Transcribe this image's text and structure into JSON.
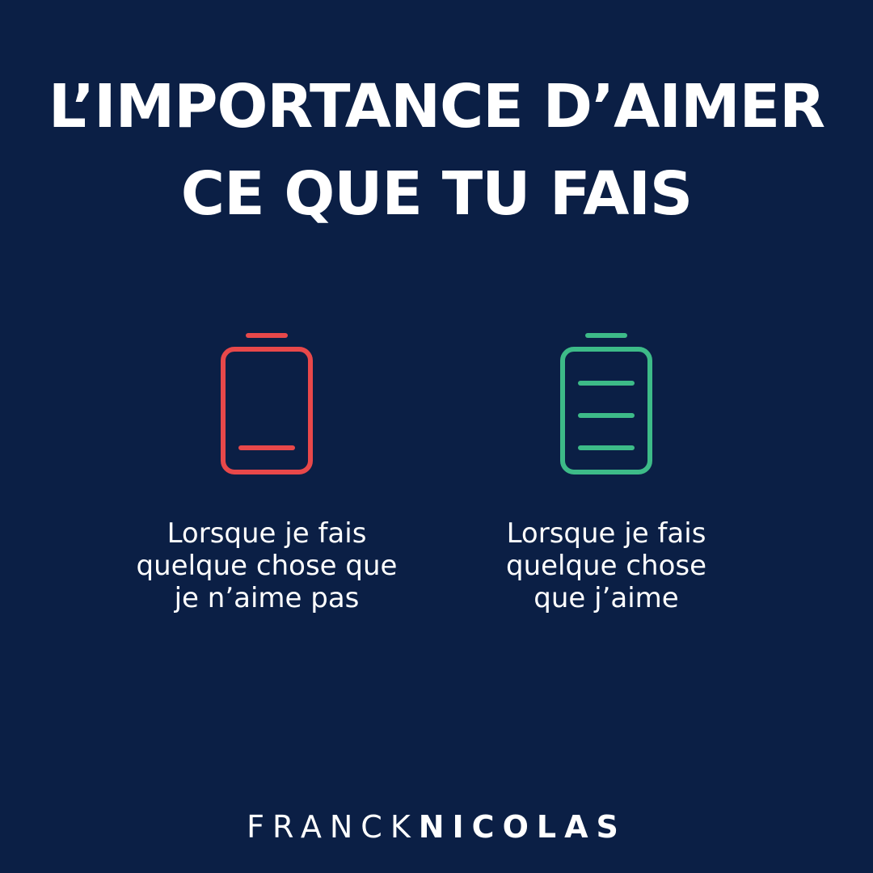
{
  "title": {
    "line1": "L’IMPORTANCE D’AIMER",
    "line2": "CE QUE TU FAIS"
  },
  "colors": {
    "background": "#0b1f45",
    "text": "#ffffff",
    "battery_low": "#e8484a",
    "battery_full": "#3dbb88"
  },
  "left": {
    "icon": "battery-low-icon",
    "charge_level": 0.25,
    "caption": [
      "Lorsque je fais",
      "quelque chose que",
      "je n’aime pas"
    ]
  },
  "right": {
    "icon": "battery-full-icon",
    "charge_level": 1.0,
    "caption": [
      "Lorsque je fais",
      "quelque chose",
      "que j’aime"
    ]
  },
  "brand": {
    "first": "FRANCK",
    "last": "NICOLAS"
  }
}
